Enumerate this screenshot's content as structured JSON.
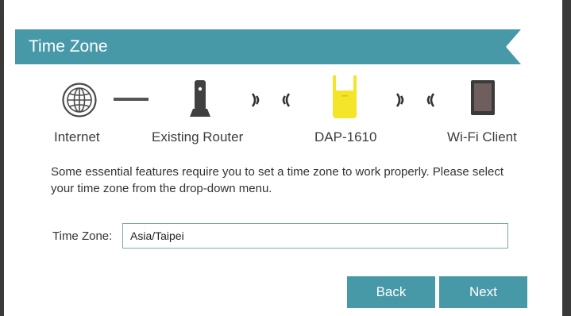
{
  "header": {
    "title": "Time Zone",
    "color": "#4799a8"
  },
  "diagram": {
    "internet_label": "Internet",
    "router_label": "Existing Router",
    "extender_label": "DAP-1610",
    "client_label": "Wi-Fi Client",
    "extender_color": "#f5e52a",
    "icons": {
      "internet": "globe-icon",
      "link": "wired-link-icon",
      "router": "router-icon",
      "wireless": "wireless-signal-icon",
      "extender": "extender-icon",
      "client": "tablet-icon"
    }
  },
  "description": "Some essential features require you to set a time zone to work properly. Please select your time zone from the drop-down menu.",
  "form": {
    "time_zone_label": "Time Zone:",
    "time_zone_value": "Asia/Taipei"
  },
  "buttons": {
    "back_label": "Back",
    "next_label": "Next",
    "color": "#4799a8"
  }
}
